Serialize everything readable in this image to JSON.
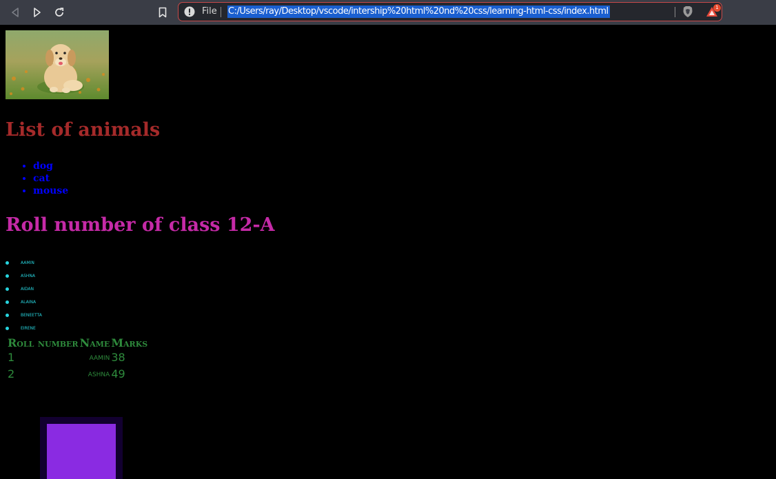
{
  "browser": {
    "url_scheme_label": "File",
    "url": "C:/Users/ray/Desktop/vscode/intership%20html%20nd%20css/learning-html-css/index.html",
    "rewards_badge": "1"
  },
  "page": {
    "animals_heading": "List of animals",
    "animals": [
      "dog",
      "cat",
      "mouse"
    ],
    "roll_heading": "Roll number of class 12-A",
    "students": [
      "AAMIN",
      "ASHNA",
      "AIDAN",
      "ALAINA",
      "BENEETTA",
      "EIRENE"
    ],
    "table": {
      "headers": [
        "Roll number",
        "Name",
        "Marks"
      ],
      "rows": [
        [
          "1",
          "aamin",
          "38"
        ],
        [
          "2",
          "ashna",
          "49"
        ]
      ]
    }
  },
  "colors": {
    "animals_heading": "#a52a2a",
    "animals_list": "#0000ff",
    "roll_heading": "#c52aa7",
    "students": "#27d6e0",
    "table": "#2e8b3c",
    "box_outer": "#120030",
    "box_inner": "#8a2be2"
  }
}
